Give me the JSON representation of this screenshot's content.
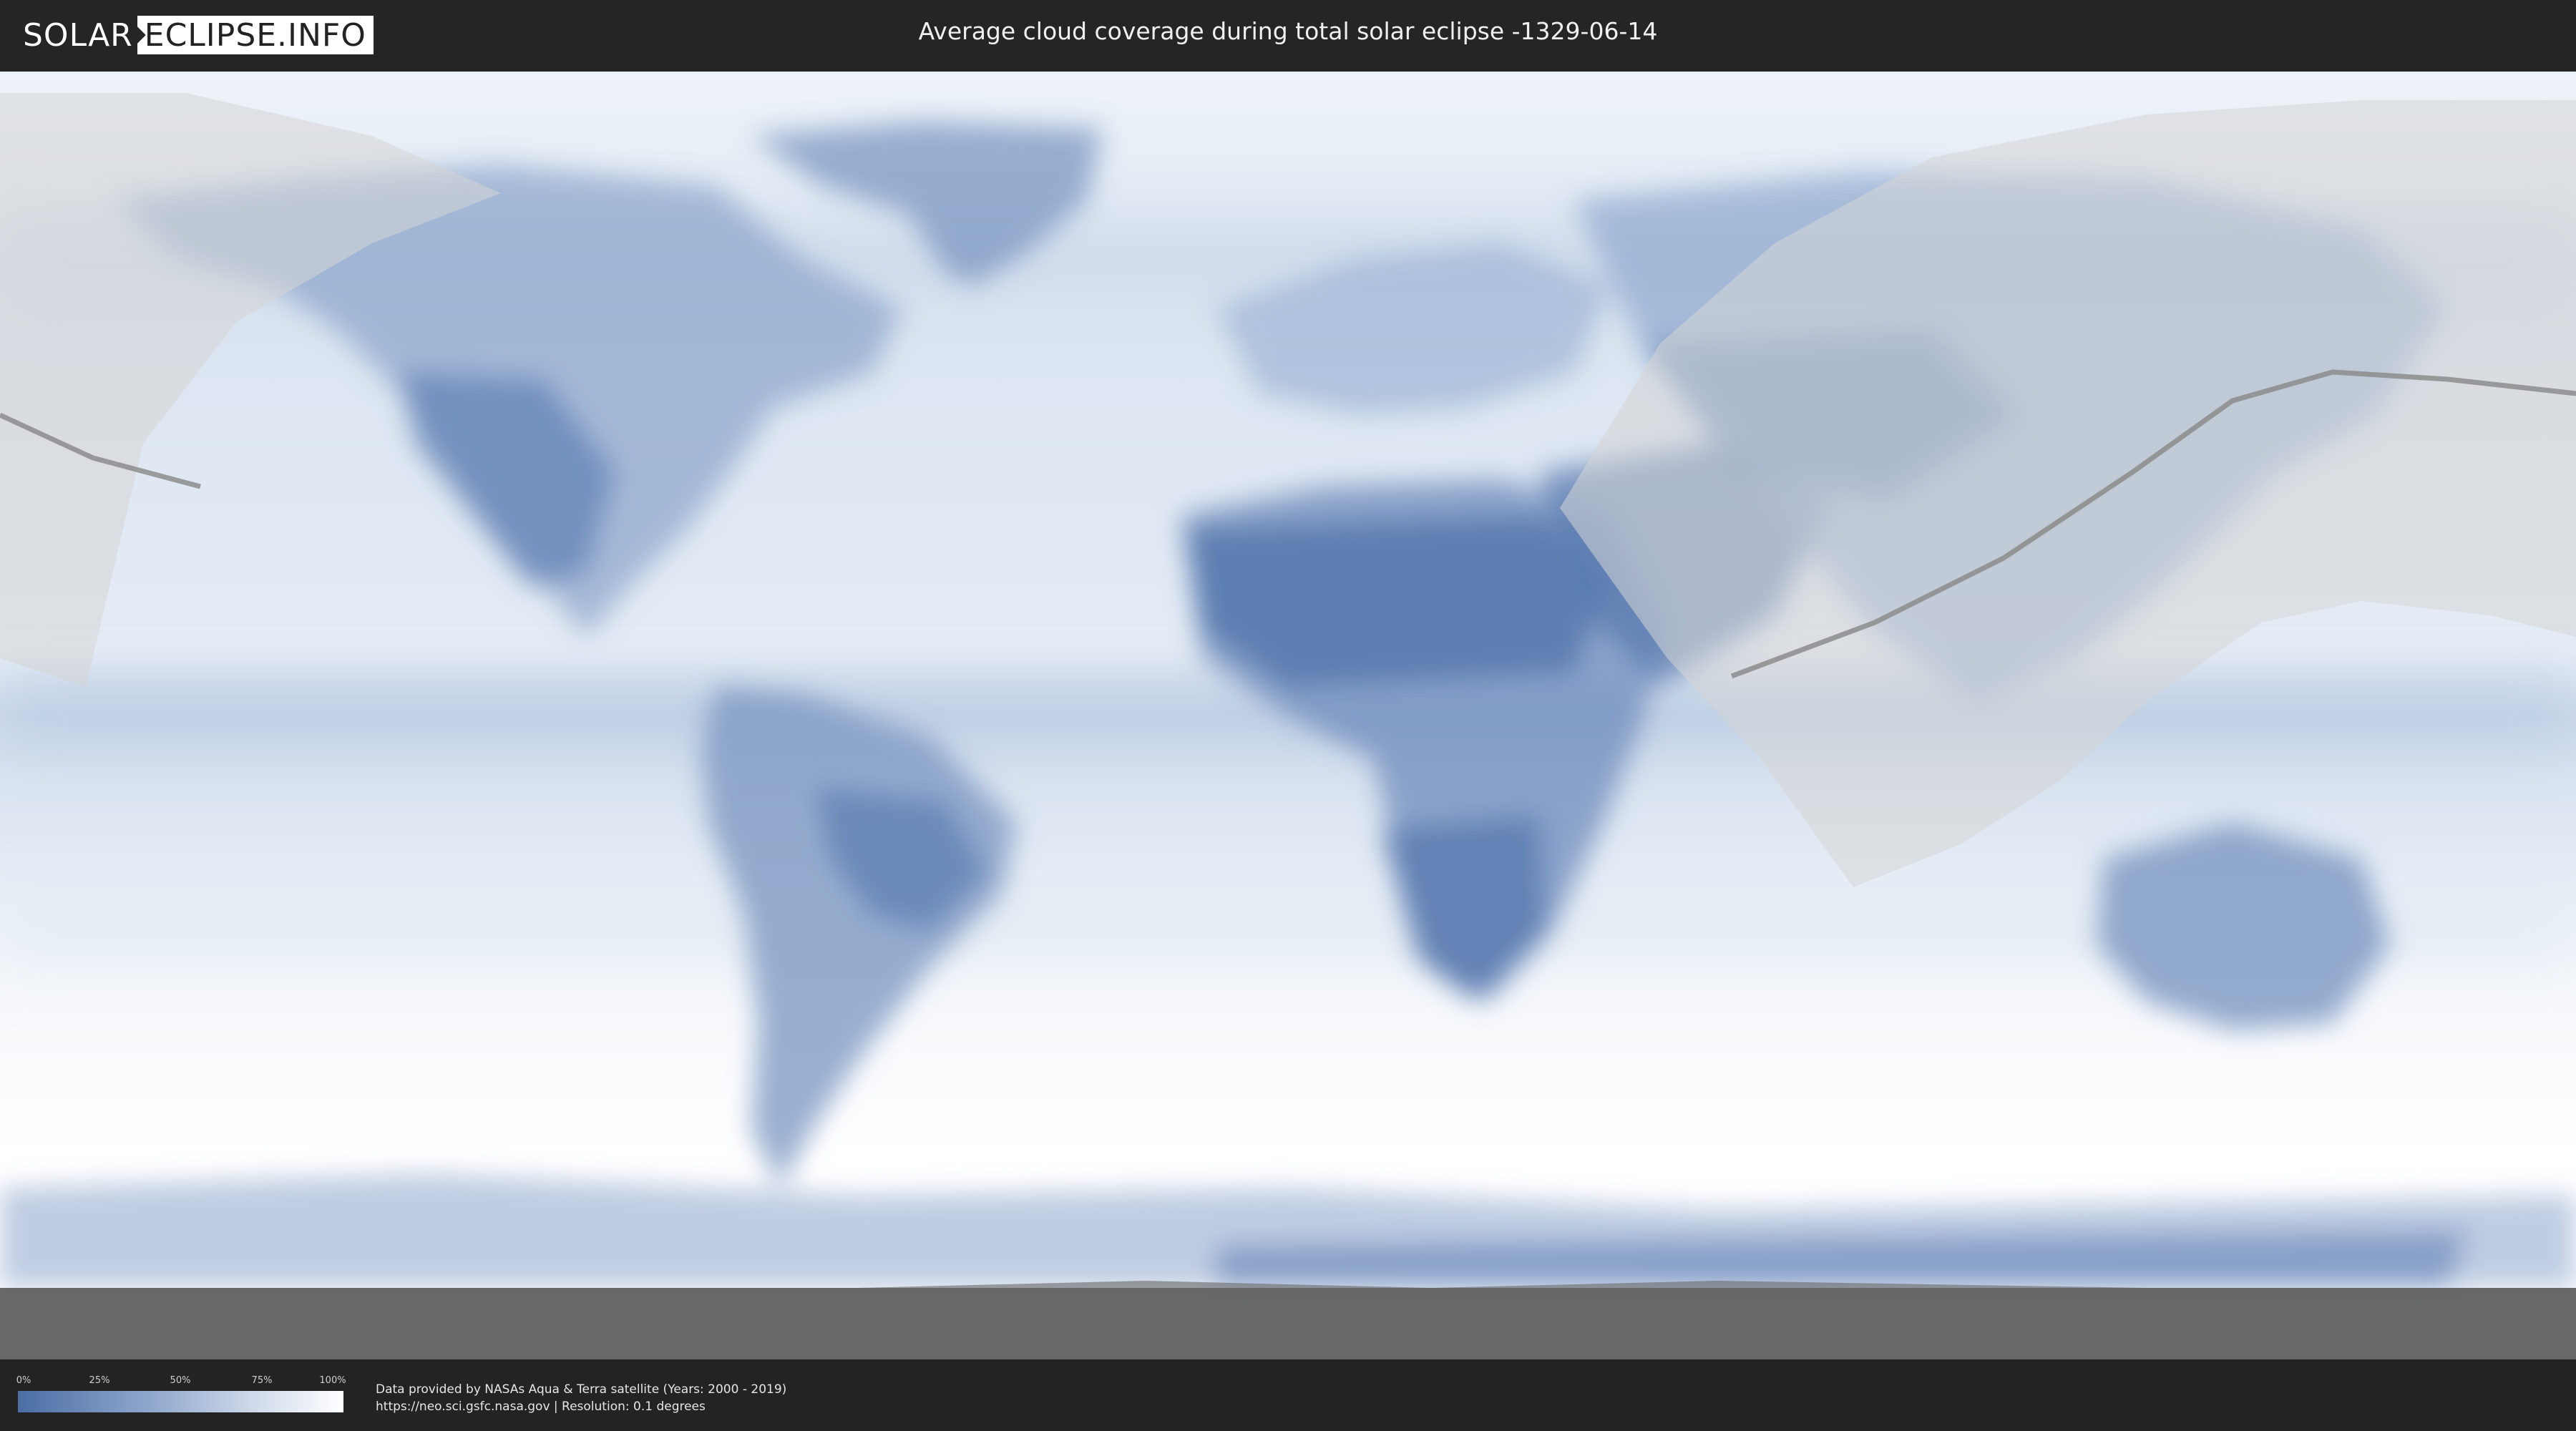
{
  "header": {
    "logo_solar": "SOLAR",
    "logo_eclipse": "ECLIPSE.INFO",
    "title": "Average cloud coverage during total solar eclipse -1329-06-14"
  },
  "legend": {
    "ticks": [
      "0%",
      "25%",
      "50%",
      "75%",
      "100%"
    ],
    "colors": {
      "low": "#4a6ea5",
      "high": "#ffffff"
    }
  },
  "credits": {
    "line1": "Data provided by NASAs Aqua & Terra satellite (Years: 2000 - 2019)",
    "line2": "https://neo.sci.gsfc.nasa.gov | Resolution: 0.1 degrees"
  },
  "map": {
    "projection": "equirectangular",
    "ocean_color": "#f2f6fb",
    "cloud_color": "#6f8fbf",
    "shadow_zone_color": "#d9d9d9",
    "eclipse_path_color": "#8c8c8c"
  }
}
